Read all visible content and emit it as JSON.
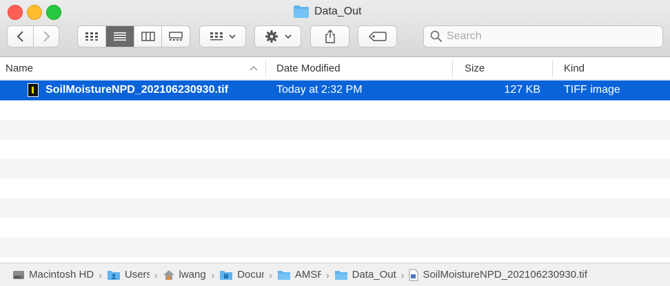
{
  "window": {
    "title": "Data_Out"
  },
  "toolbar": {
    "back_icon": "chevron-left-icon",
    "forward_icon": "chevron-right-icon",
    "views": [
      "icon-view",
      "list-view",
      "column-view",
      "gallery-view"
    ],
    "active_view": "list-view"
  },
  "search": {
    "placeholder": "Search"
  },
  "columns": [
    {
      "label": "Name",
      "sort": "ascending"
    },
    {
      "label": "Date Modified"
    },
    {
      "label": "Size"
    },
    {
      "label": "Kind"
    }
  ],
  "files": [
    {
      "name": "SoilMoistureNPD_202106230930.tif",
      "date_modified": "Today at 2:32 PM",
      "size": "127 KB",
      "kind": "TIFF image",
      "selected": true
    }
  ],
  "path": [
    {
      "label": "Macintosh HD",
      "icon": "hard-drive-icon"
    },
    {
      "label": "Users",
      "icon": "users-folder-icon"
    },
    {
      "label": "lwang",
      "icon": "home-icon"
    },
    {
      "label": "Documents",
      "icon": "documents-folder-icon"
    },
    {
      "label": "AMSR",
      "icon": "folder-icon"
    },
    {
      "label": "Data_Out",
      "icon": "folder-icon"
    },
    {
      "label": "SoilMoistureNPD_202106230930.tif",
      "icon": "tiff-file-icon"
    }
  ],
  "colors": {
    "selection": "#0a63d8",
    "folder": "#5fb3f0",
    "close": "#fe5f57",
    "minimize": "#febc2e",
    "zoom": "#28c840"
  }
}
